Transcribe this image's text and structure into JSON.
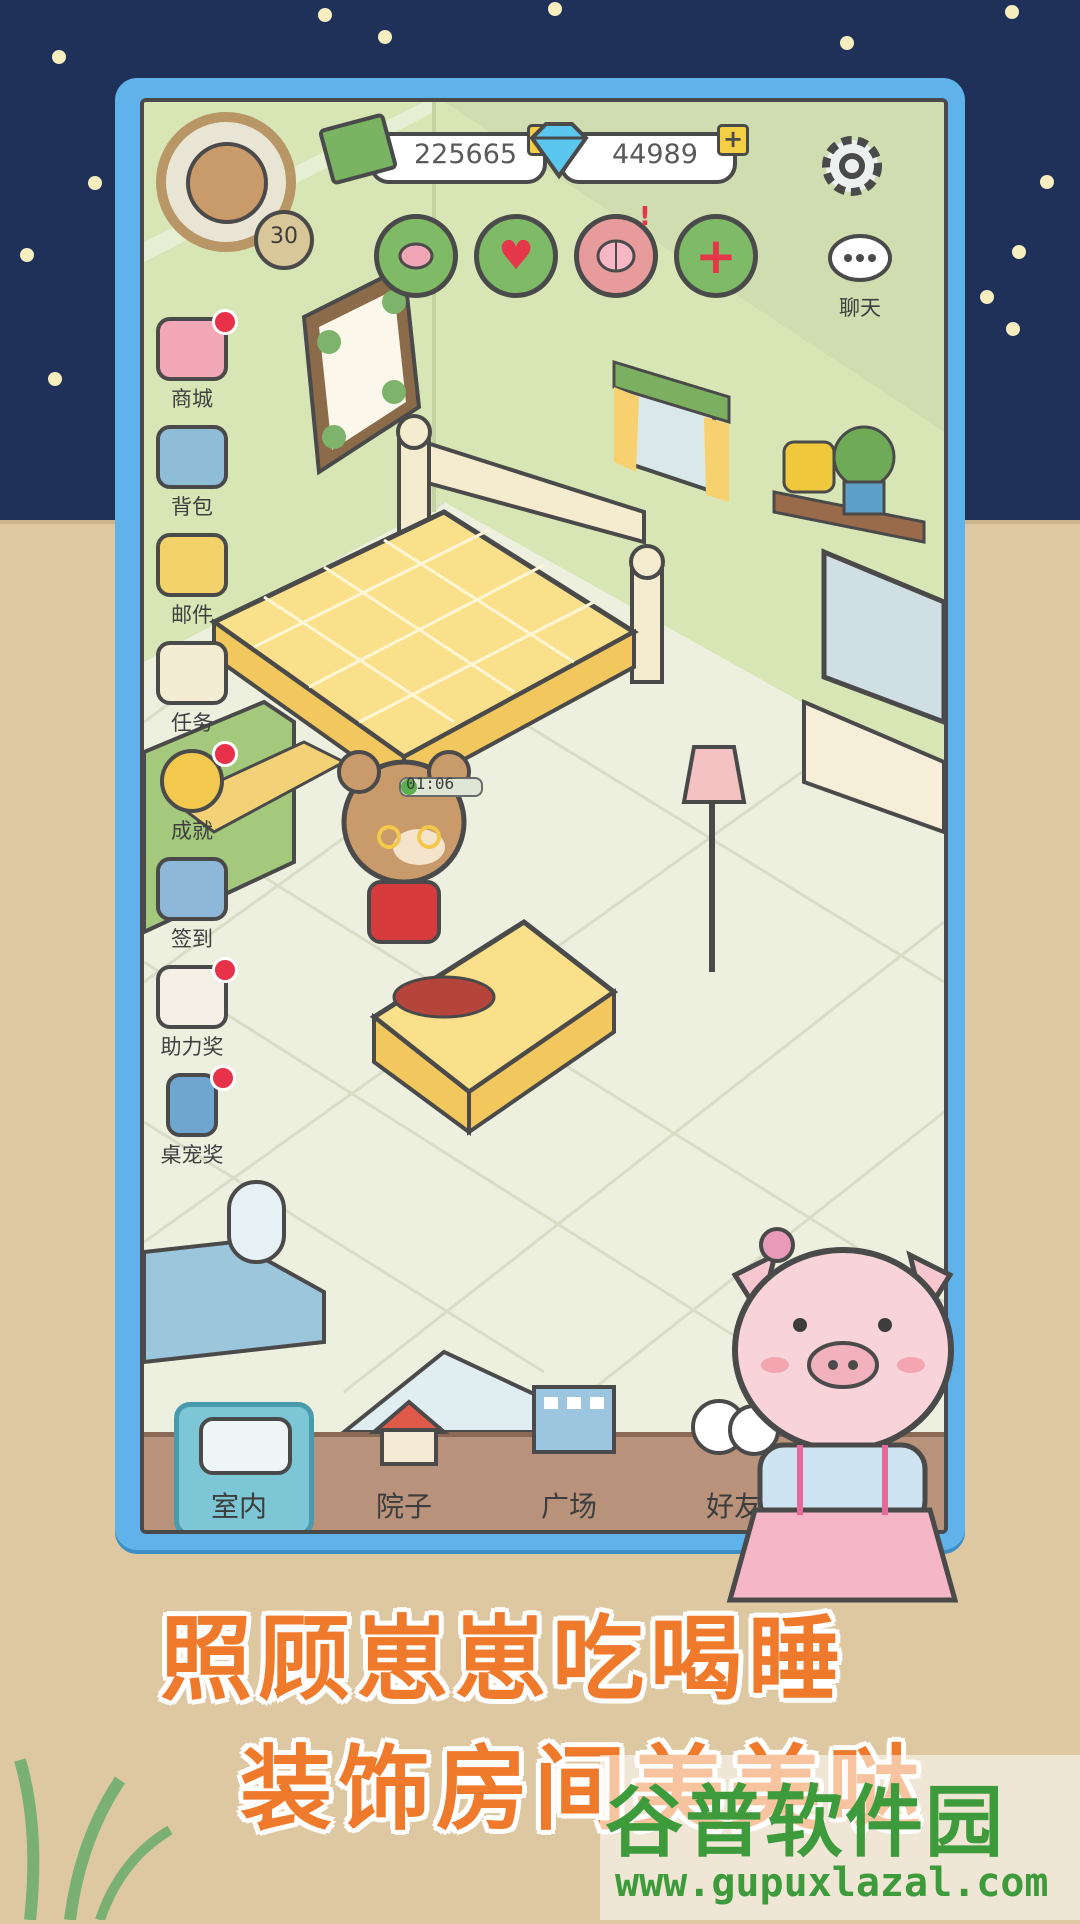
{
  "hud": {
    "level": "30",
    "coins": "225665",
    "gems": "44989",
    "chat_label": "聊天",
    "timer": "01:06"
  },
  "sidebar": {
    "items": [
      {
        "label": "商城",
        "icon": "shop-icon",
        "badge": true
      },
      {
        "label": "背包",
        "icon": "backpack-icon",
        "badge": false
      },
      {
        "label": "邮件",
        "icon": "mail-icon",
        "badge": false
      },
      {
        "label": "任务",
        "icon": "task-board-icon",
        "badge": false
      },
      {
        "label": "成就",
        "icon": "medal-icon",
        "badge": true
      },
      {
        "label": "签到",
        "icon": "checkin-icon",
        "badge": false
      },
      {
        "label": "助力奖",
        "icon": "panda-gift-icon",
        "badge": true
      },
      {
        "label": "桌宠奖",
        "icon": "phone-pet-icon",
        "badge": true
      }
    ]
  },
  "nav": {
    "tabs": [
      {
        "label": "室内",
        "icon": "bed-icon",
        "active": true
      },
      {
        "label": "院子",
        "icon": "house-icon",
        "active": false
      },
      {
        "label": "广场",
        "icon": "building-icon",
        "active": false
      },
      {
        "label": "好友",
        "icon": "panda-friends-icon",
        "active": false
      }
    ]
  },
  "caption": {
    "line1": "照顾崽崽吃喝睡",
    "line2": "装饰房间美美哒"
  },
  "watermark": {
    "title": "谷普软件园",
    "url": "www.gupuxlazal.com"
  },
  "colors": {
    "frame": "#5fb3ea",
    "caption": "#f07a2c",
    "badge": "#e8324a",
    "watermark": "#3d9b3c"
  }
}
